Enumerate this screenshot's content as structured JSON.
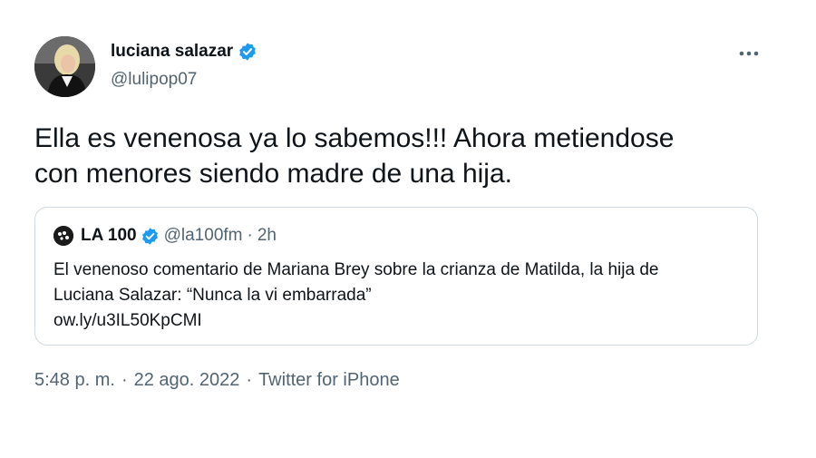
{
  "author": {
    "display_name": "luciana salazar",
    "handle": "@lulipop07",
    "verified": true
  },
  "tweet": {
    "text_lines": [
      "Ella es venenosa ya lo sabemos!!! Ahora metiendose",
      "con menores siendo madre de una hija."
    ],
    "time": "5:48 p. m.",
    "date": "22 ago. 2022",
    "source": "Twitter for iPhone",
    "separator": "·"
  },
  "quoted": {
    "display_name": "LA 100",
    "handle": "@la100fm",
    "separator": "·",
    "time": "2h",
    "body_lines": [
      "El venenoso comentario de Mariana Brey sobre la crianza de Matilda, la hija de",
      "Luciana Salazar: “Nunca la vi embarrada”",
      "ow.ly/u3IL50KpCMI"
    ]
  },
  "colors": {
    "verified_blue": "#1d9bf0",
    "secondary_text": "#536471",
    "border": "#cfd9de"
  },
  "icons": {
    "verified": "verified-badge-icon",
    "more": "more-options-icon"
  }
}
